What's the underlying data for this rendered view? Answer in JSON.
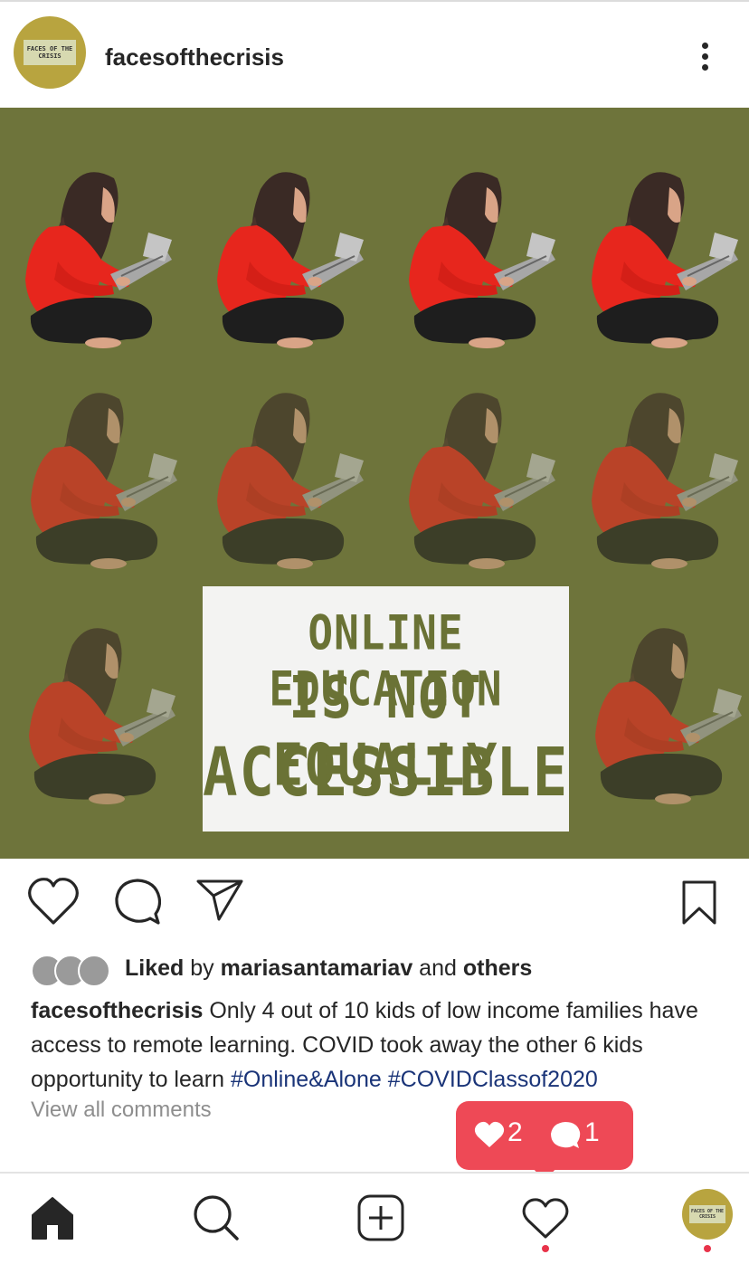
{
  "header": {
    "username": "facesofthecrisis",
    "avatar_text": "FACES OF THE CRISIS"
  },
  "post": {
    "image_text": {
      "line1": "ONLINE EDUCATION",
      "line2": "IS NOT EQUALLY",
      "line3": "ACCESSIBLE"
    },
    "colors": {
      "background": "#6e743b",
      "text": "#6a7235",
      "box": "#f3f3f2"
    },
    "likes": {
      "liked": "Liked",
      "by": " by ",
      "user": "mariasantamariav",
      "and": " and ",
      "others": "others"
    },
    "caption": {
      "username": "facesofthecrisis",
      "text": " Only 4 out of 10 kids of low income families have access to remote learning. COVID took away the other 6 kids opportunity to learn ",
      "hashtag1": "#Online&Alone",
      "hashtag2": "#COVIDClassof2020"
    },
    "view_all": "View all comments"
  },
  "notification": {
    "likes_count": "2",
    "comments_count": "1",
    "color": "#ee4956"
  },
  "nav": {
    "icons": [
      "home-icon",
      "search-icon",
      "new-post-icon",
      "activity-heart-icon",
      "profile-avatar"
    ],
    "dot_color": "#e8334a"
  }
}
